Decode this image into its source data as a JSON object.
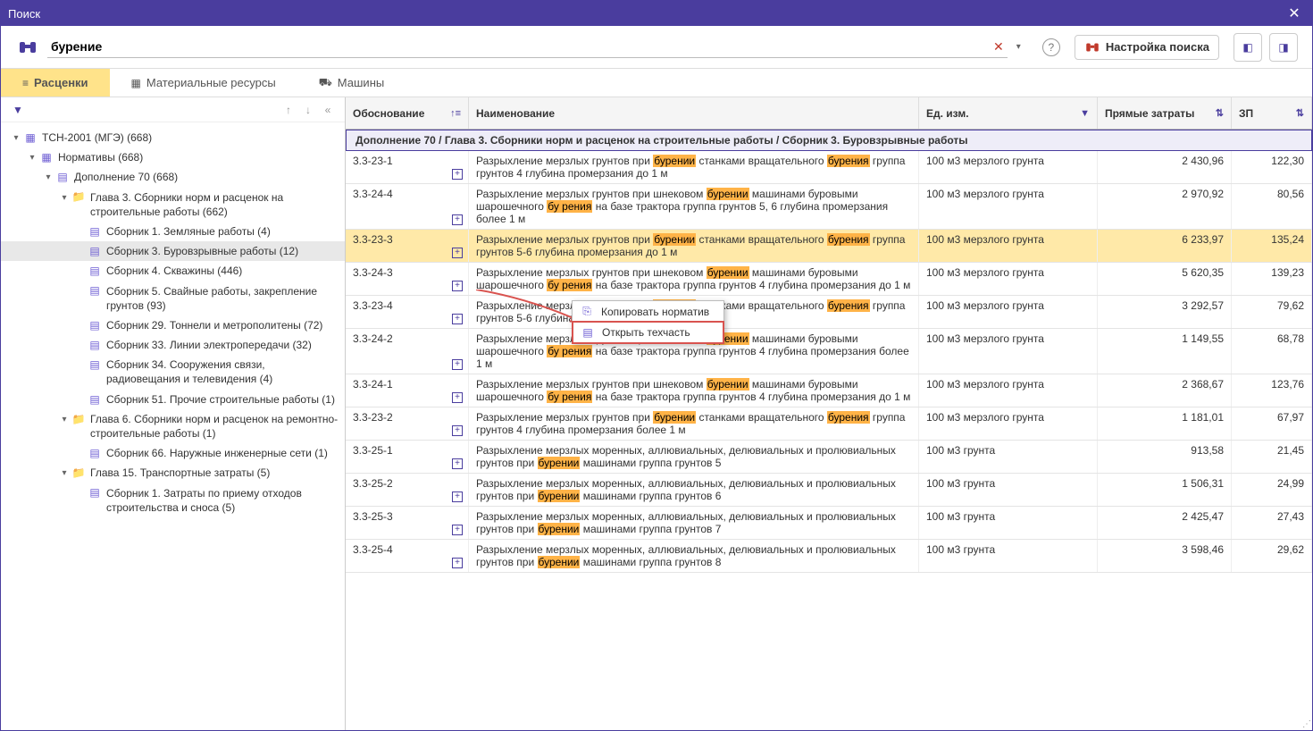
{
  "window": {
    "title": "Поиск"
  },
  "search": {
    "value": "бурение"
  },
  "buttons": {
    "settings": "Настройка поиска",
    "help": "?"
  },
  "tabs": [
    {
      "label": "Расценки",
      "icon": "≡",
      "active": true
    },
    {
      "label": "Материальные ресурсы",
      "icon": "▦",
      "active": false
    },
    {
      "label": "Машины",
      "icon": "⛟",
      "active": false
    }
  ],
  "tree": [
    {
      "depth": 0,
      "caret": "▾",
      "icon": "db",
      "label": "ТСН-2001 (МГЭ) (668)"
    },
    {
      "depth": 1,
      "caret": "▾",
      "icon": "db",
      "label": "Нормативы (668)"
    },
    {
      "depth": 2,
      "caret": "▾",
      "icon": "doc",
      "label": "Дополнение 70 (668)"
    },
    {
      "depth": 3,
      "caret": "▾",
      "icon": "folder",
      "label": "Глава  3. Сборники норм и расценок на строительные работы (662)"
    },
    {
      "depth": 4,
      "caret": "",
      "icon": "doc",
      "label": "Сборник  1. Земляные работы (4)"
    },
    {
      "depth": 4,
      "caret": "",
      "icon": "doc",
      "label": "Сборник  3. Буровзрывные работы (12)",
      "selected": true
    },
    {
      "depth": 4,
      "caret": "",
      "icon": "doc",
      "label": "Сборник  4. Скважины (446)"
    },
    {
      "depth": 4,
      "caret": "",
      "icon": "doc",
      "label": "Сборник  5. Свайные работы, закрепление грунтов (93)"
    },
    {
      "depth": 4,
      "caret": "",
      "icon": "doc",
      "label": "Сборник 29. Тоннели и метрополитены (72)"
    },
    {
      "depth": 4,
      "caret": "",
      "icon": "doc",
      "label": "Сборник 33. Линии электропередачи (32)"
    },
    {
      "depth": 4,
      "caret": "",
      "icon": "doc",
      "label": "Сборник 34. Сооружения связи, радиовещания и телевидения (4)"
    },
    {
      "depth": 4,
      "caret": "",
      "icon": "doc",
      "label": "Сборник 51. Прочие строительные работы (1)"
    },
    {
      "depth": 3,
      "caret": "▾",
      "icon": "folder",
      "label": "Глава  6. Сборники норм и расценок на ремонтно-строительные работы (1)"
    },
    {
      "depth": 4,
      "caret": "",
      "icon": "doc",
      "label": "Сборник 66. Наружные инженерные сети (1)"
    },
    {
      "depth": 3,
      "caret": "▾",
      "icon": "folder",
      "label": "Глава 15. Транспортные затраты (5)"
    },
    {
      "depth": 4,
      "caret": "",
      "icon": "doc",
      "label": "Сборник  1. Затраты по приему отходов строительства и сноса (5)"
    }
  ],
  "columns": {
    "ob": "Обоснование",
    "nm": "Наименование",
    "ed": "Ед. изм.",
    "pz": "Прямые затраты",
    "zp": "ЗП"
  },
  "breadcrumb": "Дополнение 70 / Глава 3. Сборники норм и расценок на строительные работы / Сборник 3. Буровзрывные работы",
  "rows": [
    {
      "ob": "3.3-23-1",
      "nm": "Разрыхление мерзлых грунтов при |бурении| станками вращательного |бурения| группа грунтов 4 глубина промерзания до 1 м",
      "ed": "100 м3 мерзлого грунта",
      "pz": "2 430,96",
      "zp": "122,30"
    },
    {
      "ob": "3.3-24-4",
      "nm": "Разрыхление мерзлых грунтов при шнековом |бурении| машинами буровыми шарошечного |бу рения| на базе трактора группа грунтов 5, 6 глубина промерзания более 1 м",
      "ed": "100 м3 мерзлого грунта",
      "pz": "2 970,92",
      "zp": "80,56"
    },
    {
      "ob": "3.3-23-3",
      "nm": "Разрыхление мерзлых грунтов при |бурении| станками вращательного |бурения| группа грунтов 5-6 глубина промерзания до 1 м",
      "ed": "100 м3 мерзлого грунта",
      "pz": "6 233,97",
      "zp": "135,24",
      "sel": true
    },
    {
      "ob": "3.3-24-3",
      "nm": "Разрыхление мерзлых грунтов при шнековом |бурении| машинами буровыми шарошечного |бу рения| на базе трактора группа грунтов 4 глубина промерзания до 1 м",
      "ed": "100 м3 мерзлого грунта",
      "pz": "5 620,35",
      "zp": "139,23"
    },
    {
      "ob": "3.3-23-4",
      "nm": "Разрыхление мерзлых грунтов при |бурении| станками вращательного |бурения| группа грунтов 5-6 глубина промерзания более 1 м",
      "ed": "100 м3 мерзлого грунта",
      "pz": "3 292,57",
      "zp": "79,62"
    },
    {
      "ob": "3.3-24-2",
      "nm": "Разрыхление мерзлых грунтов при шнековом |бурении| машинами буровыми шарошечного |бу рения| на базе трактора группа грунтов 4 глубина промерзания более 1 м",
      "ed": "100 м3 мерзлого грунта",
      "pz": "1 149,55",
      "zp": "68,78"
    },
    {
      "ob": "3.3-24-1",
      "nm": "Разрыхление мерзлых грунтов при шнековом |бурении| машинами буровыми шарошечного |бу рения| на базе трактора группа грунтов 4 глубина промерзания до 1 м",
      "ed": "100 м3 мерзлого грунта",
      "pz": "2 368,67",
      "zp": "123,76"
    },
    {
      "ob": "3.3-23-2",
      "nm": "Разрыхление мерзлых грунтов при |бурении| станками вращательного |бурения| группа грунтов 4 глубина промерзания более 1 м",
      "ed": "100 м3 мерзлого грунта",
      "pz": "1 181,01",
      "zp": "67,97"
    },
    {
      "ob": "3.3-25-1",
      "nm": "Разрыхление мерзлых моренных, аллювиальных, делювиальных и пролювиальных грунтов при |бурении| машинами группа грунтов 5",
      "ed": "100 м3 грунта",
      "pz": "913,58",
      "zp": "21,45"
    },
    {
      "ob": "3.3-25-2",
      "nm": "Разрыхление мерзлых моренных, аллювиальных, делювиальных и пролювиальных грунтов при |бурении| машинами группа грунтов 6",
      "ed": "100 м3 грунта",
      "pz": "1 506,31",
      "zp": "24,99"
    },
    {
      "ob": "3.3-25-3",
      "nm": "Разрыхление мерзлых моренных, аллювиальных, делювиальных и пролювиальных грунтов при |бурении| машинами группа грунтов 7",
      "ed": "100 м3 грунта",
      "pz": "2 425,47",
      "zp": "27,43"
    },
    {
      "ob": "3.3-25-4",
      "nm": "Разрыхление мерзлых моренных, аллювиальных, делювиальных и пролювиальных грунтов при |бурении| машинами группа грунтов 8",
      "ed": "100 м3 грунта",
      "pz": "3 598,46",
      "zp": "29,62"
    }
  ],
  "context_menu": {
    "copy": "Копировать норматив",
    "open": "Открыть техчасть"
  }
}
